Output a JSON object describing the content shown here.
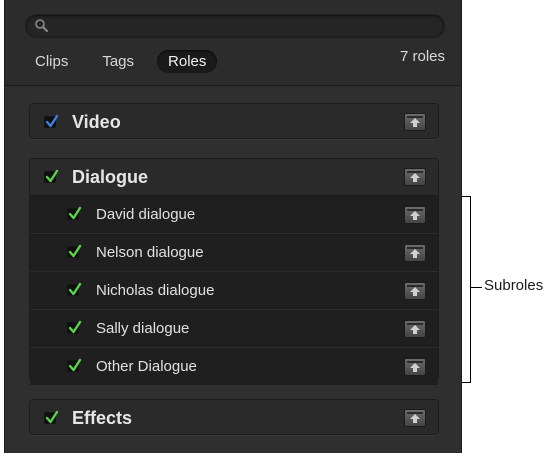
{
  "tabs": {
    "clips": "Clips",
    "tags": "Tags",
    "roles": "Roles"
  },
  "role_count": "7 roles",
  "roles": {
    "video": {
      "label": "Video",
      "checked": true,
      "check_color": "#3f7fe6"
    },
    "dialogue": {
      "label": "Dialogue",
      "checked": true,
      "check_color": "#5ad44c",
      "subroles": [
        {
          "label": "David dialogue",
          "checked": true
        },
        {
          "label": "Nelson dialogue",
          "checked": true
        },
        {
          "label": "Nicholas dialogue",
          "checked": true
        },
        {
          "label": "Sally dialogue",
          "checked": true
        },
        {
          "label": "Other Dialogue",
          "checked": true
        }
      ]
    },
    "effects": {
      "label": "Effects",
      "checked": true,
      "check_color": "#5ad44c"
    }
  },
  "callout": {
    "subroles": "Subroles"
  },
  "icons": {
    "search": "magnifier-icon",
    "check": "checkmark-icon",
    "collapse": "collapse-arrow-icon"
  }
}
